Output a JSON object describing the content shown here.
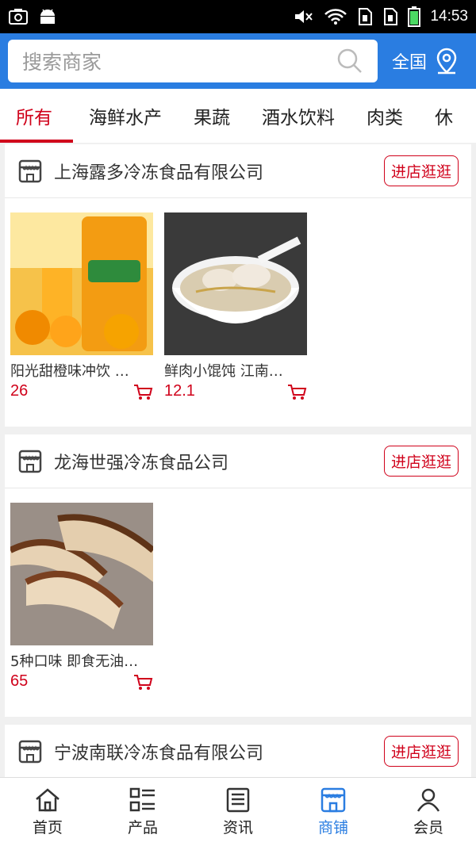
{
  "status_bar": {
    "time": "14:53"
  },
  "search": {
    "placeholder": "搜索商家"
  },
  "region": {
    "label": "全国"
  },
  "tabs": [
    {
      "label": "所有",
      "active": true
    },
    {
      "label": "海鲜水产"
    },
    {
      "label": "果蔬"
    },
    {
      "label": "酒水饮料"
    },
    {
      "label": "肉类"
    },
    {
      "label": "休"
    }
  ],
  "shops": [
    {
      "name": "上海露多冷冻食品有限公司",
      "enter_label": "进店逛逛",
      "products": [
        {
          "name": "阳光甜橙味冲饮 …",
          "price": "26"
        },
        {
          "name": "鲜肉小馄饨 江南…",
          "price": "12.1"
        }
      ]
    },
    {
      "name": "龙海世强冷冻食品公司",
      "enter_label": "进店逛逛",
      "products": [
        {
          "name": "5种口味 即食无油…",
          "price": "65"
        }
      ]
    },
    {
      "name": "宁波南联冷冻食品有限公司",
      "enter_label": "进店逛逛",
      "products": []
    }
  ],
  "bottom_nav": [
    {
      "label": "首页",
      "icon": "home-icon"
    },
    {
      "label": "产品",
      "icon": "list-icon"
    },
    {
      "label": "资讯",
      "icon": "news-icon"
    },
    {
      "label": "商铺",
      "icon": "store-icon",
      "active": true
    },
    {
      "label": "会员",
      "icon": "user-icon"
    }
  ],
  "colors": {
    "primary": "#2a7de1",
    "accent": "#d0021b"
  }
}
